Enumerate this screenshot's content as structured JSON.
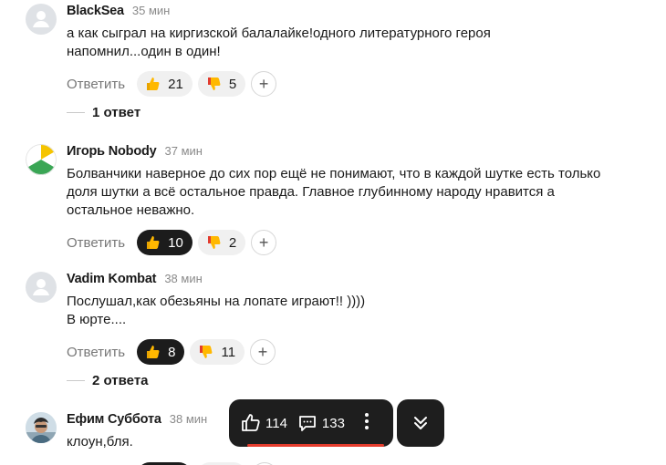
{
  "comments": [
    {
      "author": "BlackSea",
      "time": "35 мин",
      "lines": [
        "а как сыграл на киргизской балалайке!одного литературного героя",
        "напомнил...один в один!"
      ],
      "reply_label": "Ответить",
      "likes": "21",
      "dislikes": "5",
      "replies_label": "1 ответ"
    },
    {
      "author": "Игорь Nobody",
      "time": "37 мин",
      "lines": [
        "Болванчики наверное до сих пор ещё не понимают, что в каждой шутке есть только",
        "доля шутки а всё остальное правда. Главное глубинному народу нравится а",
        "остальное неважно."
      ],
      "reply_label": "Ответить",
      "likes": "10",
      "dislikes": "2"
    },
    {
      "author": "Vadim Kombat",
      "time": "38 мин",
      "lines": [
        "Послушал,как обезьяны на лопате играют!! ))))",
        "В юрте...."
      ],
      "reply_label": "Ответить",
      "likes": "8",
      "dislikes": "11",
      "replies_label": "2 ответа"
    },
    {
      "author": "Ефим Суббота",
      "time": "38 мин",
      "lines": [
        "клоун,бля."
      ]
    }
  ],
  "floatbar": {
    "likes_count": "114",
    "comments_count": "133"
  },
  "icons": {
    "like": "thumbs-up-icon",
    "comment": "comment-icon",
    "more": "more-vertical-icon",
    "scroll": "double-chevron-down-icon"
  },
  "colors": {
    "accent_red": "#e53c2d",
    "dark": "#1e1e1e"
  }
}
